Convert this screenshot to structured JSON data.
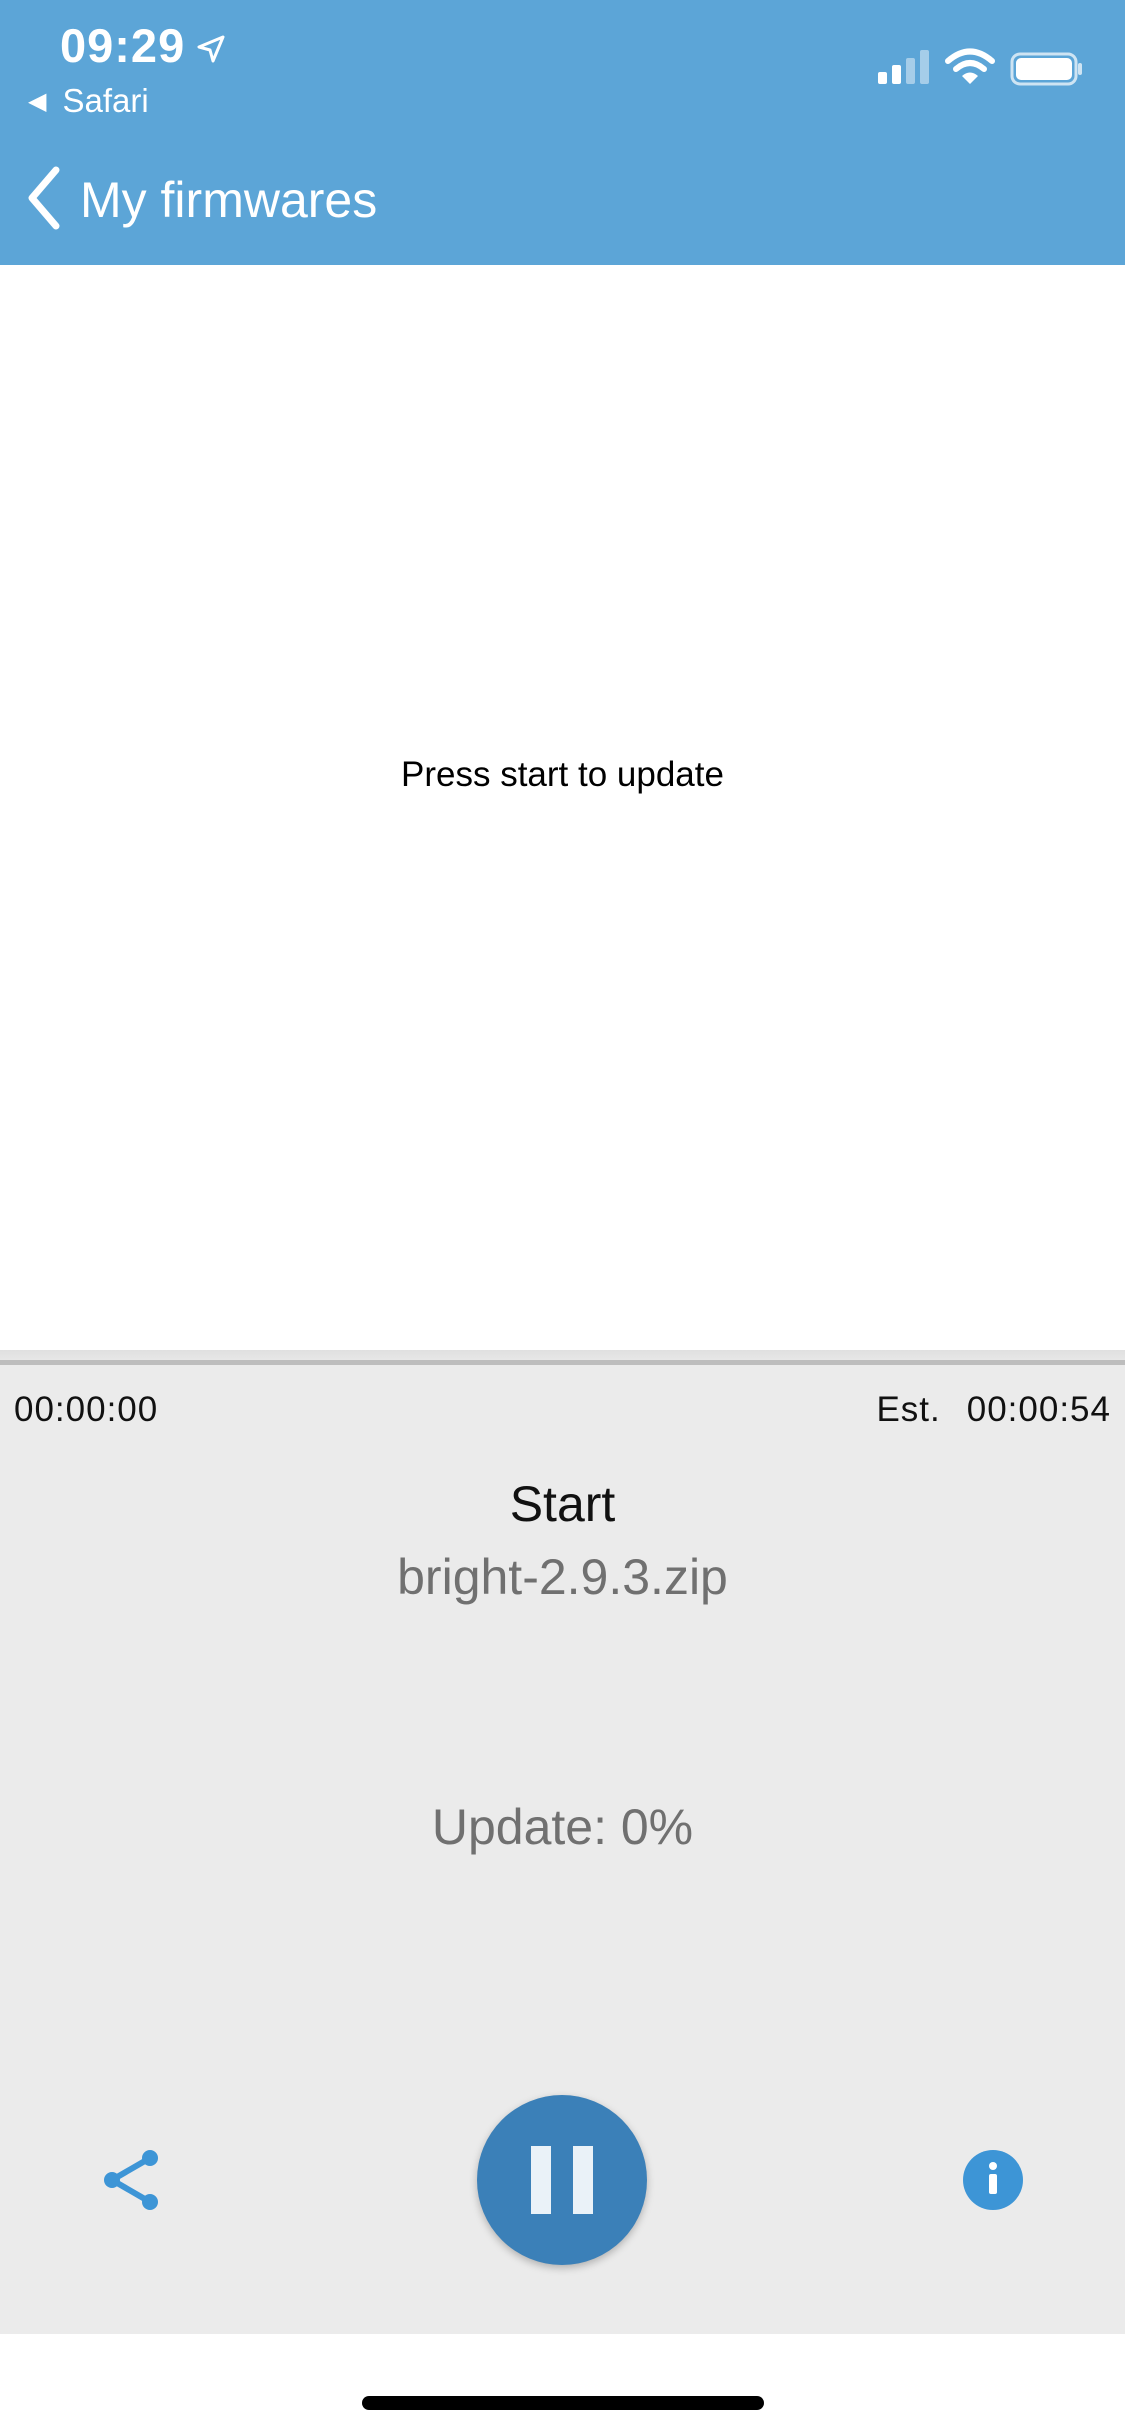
{
  "status_bar": {
    "time": "09:29",
    "back_app": "Safari",
    "location_icon": "location-arrow-icon",
    "signal_icon": "cellular-signal-icon",
    "wifi_icon": "wifi-icon",
    "battery_icon": "battery-icon"
  },
  "nav": {
    "back_label": "My firmwares",
    "back_icon": "chevron-left-icon",
    "bar_color": "#5ca5d7"
  },
  "main": {
    "message": "Press start to update"
  },
  "panel": {
    "elapsed": "00:00:00",
    "estimate_label": "Est.",
    "estimate_value": "00:00:54",
    "progress_fraction": 0,
    "state": "Start",
    "file_name": "bright-2.9.3.zip",
    "update_text": "Update: 0%",
    "accent_color": "#3b80b8"
  },
  "controls": {
    "share_icon": "share-icon",
    "pause_icon": "pause-icon",
    "info_icon": "info-icon"
  }
}
